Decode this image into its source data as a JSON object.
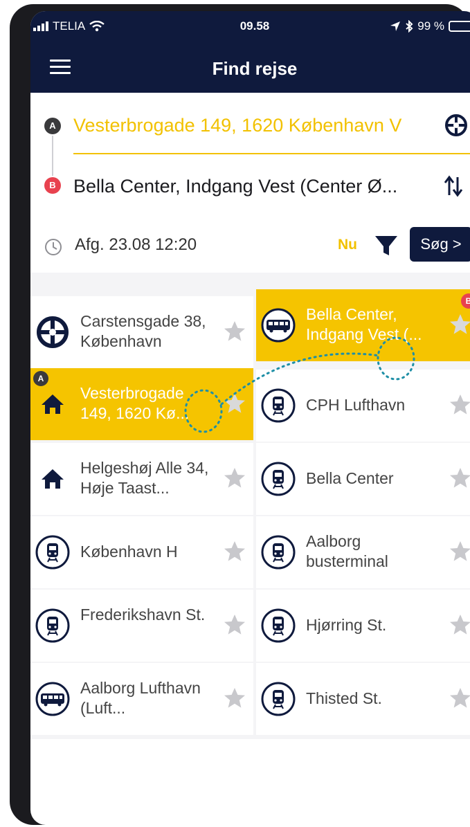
{
  "status_bar": {
    "carrier": "TELIA",
    "time": "09.58",
    "battery": "99 %"
  },
  "header": {
    "title": "Find rejse"
  },
  "search": {
    "from_marker": "A",
    "to_marker": "B",
    "from_value": "Vesterbrogade 149, 1620 København V",
    "to_value": "Bella Center, Indgang Vest (Center Ø...",
    "departure": "Afg. 23.08 12:20",
    "now_label": "Nu",
    "search_button": "Søg >"
  },
  "colors": {
    "navy": "#0f1a3d",
    "accent": "#f5c400",
    "marker_b": "#e8424f",
    "star": "#c8c8cc"
  },
  "places": [
    {
      "label": "Carstensgade 38, København",
      "icon": "location-target-icon",
      "starred": false,
      "highlighted": false
    },
    {
      "label": "Bella Center, Indgang Vest (...",
      "icon": "bus-icon",
      "starred": false,
      "highlighted": true,
      "badge": "B"
    },
    {
      "label": "Vesterbrogade 149, 1620 Kø...",
      "icon": "home-icon",
      "starred": false,
      "highlighted": true,
      "badge": "A"
    },
    {
      "label": "CPH Lufthavn",
      "icon": "train-icon",
      "starred": false,
      "highlighted": false
    },
    {
      "label": "Helgeshøj Alle 34, Høje Taast...",
      "icon": "home-icon",
      "starred": false,
      "highlighted": false
    },
    {
      "label": "Bella Center",
      "icon": "train-icon",
      "starred": false,
      "highlighted": false
    },
    {
      "label": "København H",
      "icon": "train-icon",
      "starred": false,
      "highlighted": false
    },
    {
      "label": "Aalborg busterminal",
      "icon": "train-icon",
      "starred": false,
      "highlighted": false
    },
    {
      "label": "Frederikshavn St.",
      "icon": "train-icon",
      "starred": false,
      "highlighted": false
    },
    {
      "label": "Hjørring St.",
      "icon": "train-icon",
      "starred": false,
      "highlighted": false
    },
    {
      "label": "Aalborg Lufthavn (Luft...",
      "icon": "bus-icon",
      "starred": false,
      "highlighted": false
    },
    {
      "label": "Thisted St.",
      "icon": "train-icon",
      "starred": false,
      "highlighted": false
    }
  ]
}
